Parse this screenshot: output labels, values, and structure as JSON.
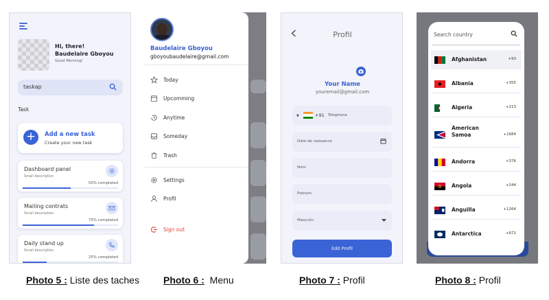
{
  "tasks_screen": {
    "greeting": "Hi, there!",
    "user_name": "Baudelaire Gboyou",
    "subgreeting": "Good Morning!",
    "search_value": "taskap",
    "section_label": "Task",
    "add_task": {
      "title": "Add a new task",
      "subtitle": "Create your new task"
    },
    "tasks": [
      {
        "title": "Dashboard panel",
        "description": "Small description",
        "progress_label": "50% completed",
        "progress": 0.5,
        "icon": "gear-icon"
      },
      {
        "title": "Mailing contrats",
        "description": "Small description",
        "progress_label": "75% completed",
        "progress": 0.75,
        "icon": "mail-icon"
      },
      {
        "title": "Daily stand up",
        "description": "Small description",
        "progress_label": "25% completed",
        "progress": 0.25,
        "icon": "phone-icon"
      }
    ]
  },
  "menu_screen": {
    "name": "Baudelaire Gboyou",
    "email": "gboyoubaudelaire@gmail.com",
    "items": [
      "Today",
      "Upcomming",
      "Anytime",
      "Someday",
      "Trash"
    ],
    "settings": "Settings",
    "profile": "Profil",
    "sign_out": "Sign out",
    "sign_out_color": "#e0403b"
  },
  "profile_screen": {
    "title": "Profil",
    "name": "Your Name",
    "email": "youremail@gmail.com",
    "phone_code": "+91",
    "phone_placeholder": "Telephone",
    "birth_placeholder": "Date de naissance",
    "lastname_placeholder": "Nom",
    "firstname_placeholder": "Prénom",
    "gender_value": "Masculin",
    "button": "Edit Profil",
    "accent": "#3a63d6"
  },
  "country_screen": {
    "search_placeholder": "Search country",
    "countries": [
      {
        "name": "Afghanistan",
        "code": "+93"
      },
      {
        "name": "Albania",
        "code": "+355"
      },
      {
        "name": "Algeria",
        "code": "+213"
      },
      {
        "name": "American Samoa",
        "code": "+1684"
      },
      {
        "name": "Andorra",
        "code": "+376"
      },
      {
        "name": "Angola",
        "code": "+244"
      },
      {
        "name": "Anguilla",
        "code": "+1264"
      },
      {
        "name": "Antarctica",
        "code": "+672"
      }
    ]
  },
  "captions": [
    {
      "label": "Photo 5 :",
      "text": " Liste des taches"
    },
    {
      "label": "Photo 6 :",
      "text": "  Menu"
    },
    {
      "label": "Photo 7 :",
      "text": " Profil"
    },
    {
      "label": "Photo 8 :",
      "text": " Profil"
    }
  ]
}
